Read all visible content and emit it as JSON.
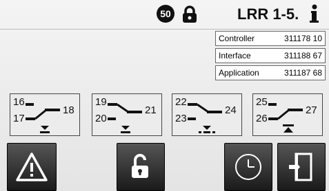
{
  "header": {
    "badge_number": "50",
    "device_label": "LRR 1-5.",
    "icons": [
      "lock-icon",
      "info-icon"
    ]
  },
  "versions": [
    {
      "label": "Controller",
      "value": "311178  10"
    },
    {
      "label": "Interface",
      "value": "311188  67"
    },
    {
      "label": "Application",
      "value": "311187 68"
    }
  ],
  "relay_panels": [
    {
      "top": "16",
      "left_bottom": "17",
      "right": "18",
      "icon": "arrow-down-icon"
    },
    {
      "top": "19",
      "left_bottom": "20",
      "right": "21",
      "icon": "arrow-down-icon"
    },
    {
      "top": "22",
      "left_bottom": "23",
      "right": "24",
      "icon": "arrow-down-dots-icon"
    },
    {
      "top": "25",
      "left_bottom": "26",
      "right": "27",
      "icon": "arrow-up-icon"
    }
  ],
  "bottom_buttons": [
    "warning-icon",
    "unlock-icon",
    "clock-icon",
    "exit-door-icon"
  ],
  "colors": {
    "background": "#e8e8e8",
    "button": "#333333",
    "text": "#111111"
  }
}
